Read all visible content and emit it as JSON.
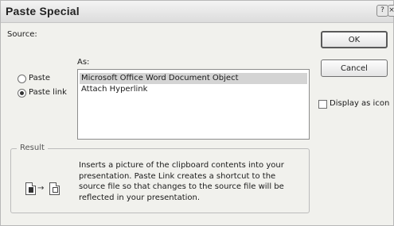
{
  "dialog": {
    "title": "Paste Special",
    "help_icon": "?",
    "close_icon": "×"
  },
  "source": {
    "label": "Source:"
  },
  "as": {
    "label": "As:",
    "items": [
      {
        "label": "Microsoft Office Word Document Object",
        "selected": true
      },
      {
        "label": "Attach Hyperlink",
        "selected": false
      }
    ]
  },
  "options": {
    "paste_label": "Paste",
    "paste_link_label": "Paste link",
    "selected": "Paste link"
  },
  "buttons": {
    "ok": "OK",
    "cancel": "Cancel"
  },
  "display_as_icon": {
    "label": "Display as icon",
    "checked": false
  },
  "result": {
    "label": "Result",
    "text": "Inserts a picture of the clipboard contents into your presentation. Paste Link creates a shortcut to the source file so that changes to the source file will be reflected in your presentation.",
    "icons": [
      "document-icon",
      "arrow-right-icon",
      "document-icon"
    ]
  }
}
